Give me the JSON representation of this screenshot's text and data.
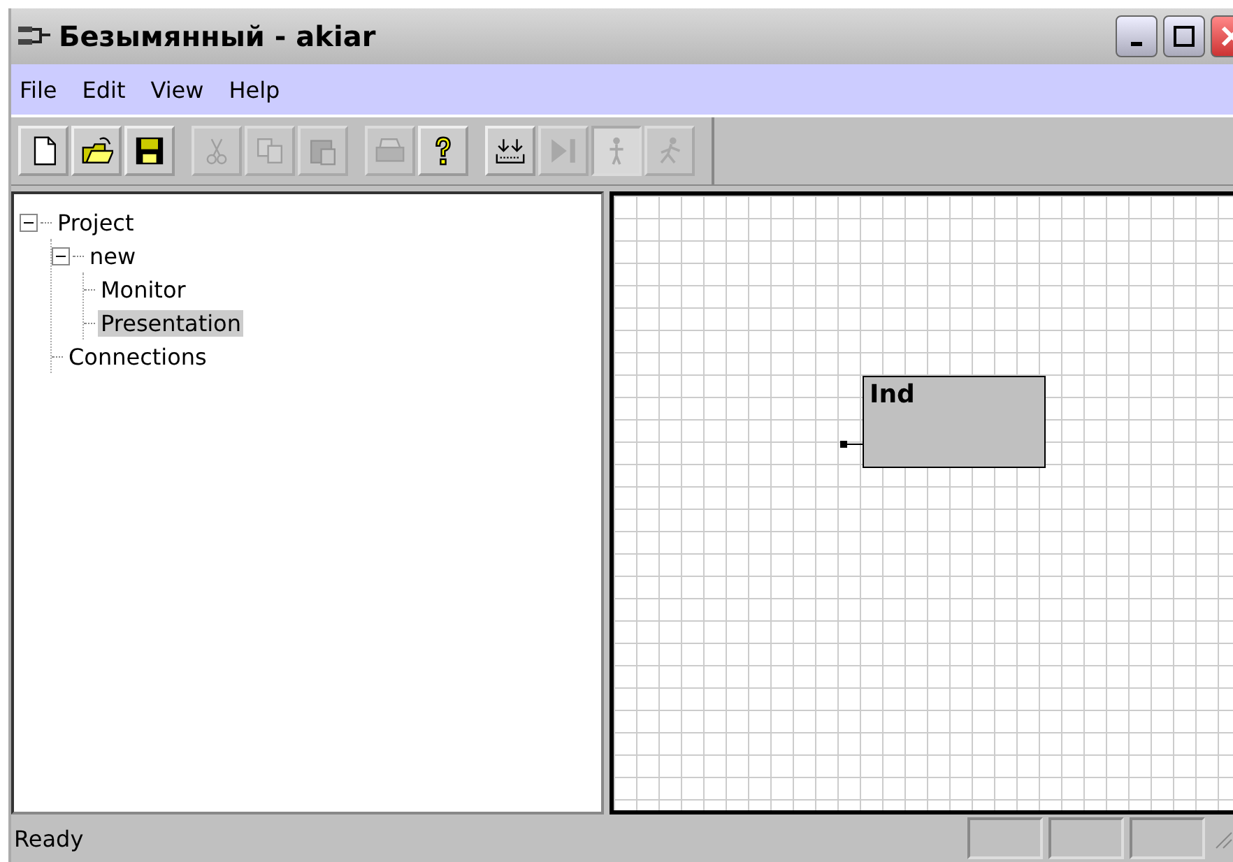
{
  "window": {
    "title": "Безымянный - akiar"
  },
  "menu": [
    "File",
    "Edit",
    "View",
    "Help"
  ],
  "toolbar": [
    [
      {
        "kind": "new",
        "disabled": false,
        "pressed": false
      },
      {
        "kind": "open",
        "disabled": false,
        "pressed": false
      },
      {
        "kind": "save",
        "disabled": false,
        "pressed": false
      }
    ],
    [
      {
        "kind": "cut",
        "disabled": true,
        "pressed": false
      },
      {
        "kind": "copy",
        "disabled": true,
        "pressed": false
      },
      {
        "kind": "paste",
        "disabled": true,
        "pressed": false
      }
    ],
    [
      {
        "kind": "print",
        "disabled": true,
        "pressed": false
      },
      {
        "kind": "help",
        "disabled": false,
        "pressed": false
      }
    ],
    [
      {
        "kind": "insert",
        "disabled": false,
        "pressed": false
      },
      {
        "kind": "step",
        "disabled": true,
        "pressed": false
      },
      {
        "kind": "stand",
        "disabled": true,
        "pressed": true
      },
      {
        "kind": "run",
        "disabled": true,
        "pressed": false
      }
    ]
  ],
  "tree": [
    {
      "label": "Project",
      "expanded": true,
      "selected": false,
      "children": [
        {
          "label": "new",
          "expanded": true,
          "selected": false,
          "children": [
            {
              "label": "Monitor",
              "selected": false
            },
            {
              "label": "Presentation",
              "selected": true
            }
          ]
        },
        {
          "label": "Connections",
          "selected": false
        }
      ]
    }
  ],
  "canvas": {
    "blocks": [
      {
        "label": "Ind"
      }
    ]
  },
  "status_bar": {
    "text": "Ready"
  }
}
